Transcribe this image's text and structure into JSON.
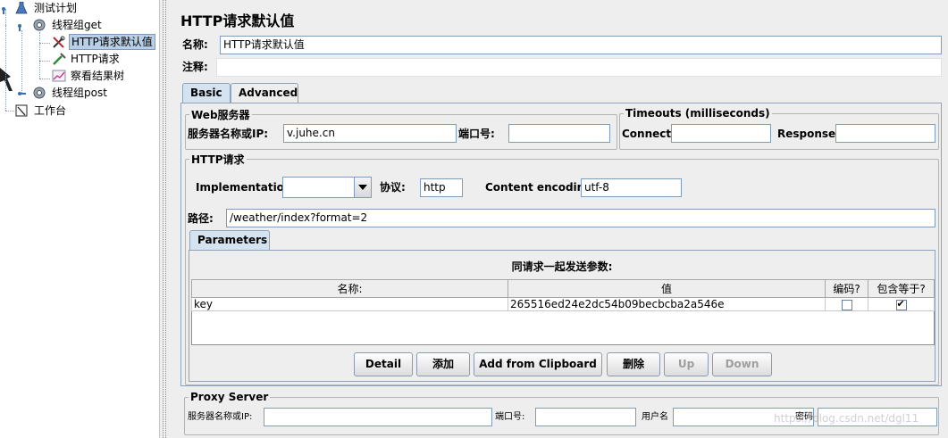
{
  "tree": {
    "test_plan": "测试计划",
    "thread_group_get": "线程组get",
    "http_defaults": "HTTP请求默认值",
    "http_request": "HTTP请求",
    "view_results_tree": "察看结果树",
    "thread_group_post": "线程组post",
    "workbench": "工作台"
  },
  "panel": {
    "title": "HTTP请求默认值",
    "name_label": "名称:",
    "name_value": "HTTP请求默认值",
    "comments_label": "注释:",
    "comments_value": ""
  },
  "tabs": {
    "basic": "Basic",
    "advanced": "Advanced"
  },
  "web_server": {
    "legend": "Web服务器",
    "server_label": "服务器名称或IP:",
    "server_value": "v.juhe.cn",
    "port_label": "端口号:",
    "port_value": ""
  },
  "timeouts": {
    "legend": "Timeouts (milliseconds)",
    "connect_label": "Connect:",
    "connect_value": "",
    "response_label": "Response:",
    "response_value": ""
  },
  "http_request": {
    "legend": "HTTP请求",
    "implementation_label": "Implementation:",
    "implementation_value": "",
    "protocol_label": "协议:",
    "protocol_value": "http",
    "encoding_label": "Content encoding:",
    "encoding_value": "utf-8",
    "path_label": "路径:",
    "path_value": "/weather/index?format=2"
  },
  "parameters": {
    "tab_label": "Parameters",
    "caption": "同请求一起发送参数:",
    "columns": [
      "名称:",
      "值",
      "编码?",
      "包含等于?"
    ],
    "rows": [
      {
        "name": "key",
        "value": "265516ed24e2dc54b09becbcba2a546e",
        "encode": false,
        "include_equals": true
      }
    ]
  },
  "buttons": {
    "detail": "Detail",
    "add": "添加",
    "add_from_clipboard": "Add from Clipboard",
    "delete": "删除",
    "up": "Up",
    "down": "Down"
  },
  "proxy": {
    "legend": "Proxy Server",
    "server_label": "服务器名称或IP:",
    "server_value": "",
    "port_label": "端口号:",
    "port_value": "",
    "user_label": "用户名",
    "user_value": "",
    "password_label": "密码",
    "password_value": ""
  },
  "watermark": "https://blog.csdn.net/dgl11",
  "colors": {
    "tree_selected": "#b8cfe5",
    "tab_active": "#d5e2f0",
    "field_border": "#7f9db9"
  }
}
